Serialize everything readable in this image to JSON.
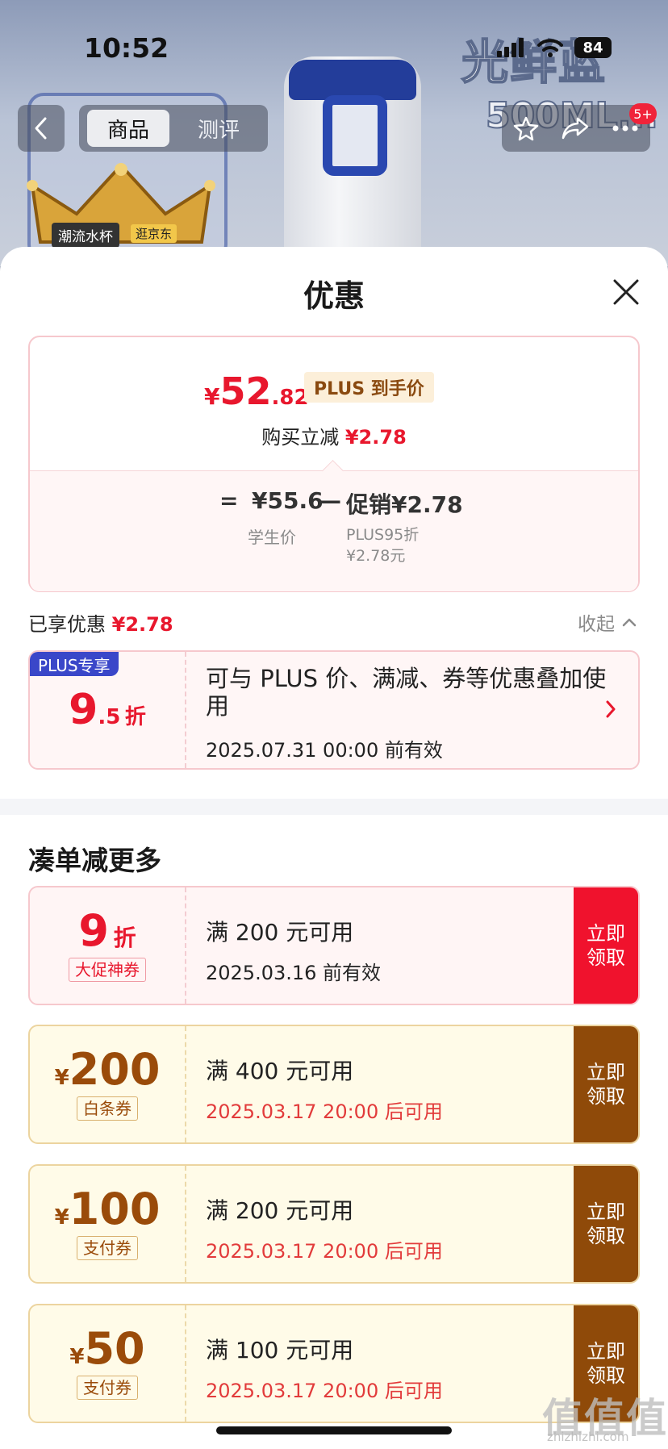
{
  "status_bar": {
    "time": "10:52",
    "battery": "84"
  },
  "hero": {
    "title": "光鲜蓝",
    "subtitle": "500ML...",
    "crown_tag": "潮流水杯",
    "crown_tag2": "逛京东"
  },
  "nav": {
    "tabs": [
      {
        "label": "商品"
      },
      {
        "label": "测评"
      }
    ],
    "badge": "5+"
  },
  "sheet": {
    "title": "优惠",
    "price_card": {
      "yen": "¥",
      "price_int": "52",
      "price_dec": ".82",
      "tag": "PLUS 到手价",
      "reduce_label": "购买立减",
      "reduce_value": "¥2.78",
      "eq": "=",
      "student_price": "¥55.6",
      "minus": "—",
      "promo": "促销¥2.78",
      "student_label": "学生价",
      "plus_label_1": "PLUS95折",
      "plus_label_2": "¥2.78元"
    },
    "enjoyed_label": "已享优惠",
    "enjoyed_value": "¥2.78",
    "collapse_label": "收起",
    "plus_coupon": {
      "corner": "PLUS专享",
      "disc_num": "9",
      "disc_dec": ".5",
      "disc_unit": "折",
      "desc": "可与 PLUS 价、满减、券等优惠叠加使用",
      "valid": "2025.07.31 00:00 前有效"
    },
    "section_title": "凑单减更多",
    "coupons": [
      {
        "yen": "",
        "num": "9",
        "unit": "折",
        "type": "大促神券",
        "cond": "满 200 元可用",
        "valid": "2025.03.16 前有效",
        "claim": "立即领取"
      },
      {
        "yen": "¥",
        "num": "200",
        "unit": "",
        "type": "白条券",
        "cond": "满 400 元可用",
        "valid": "2025.03.17 20:00 后可用",
        "claim": "立即领取"
      },
      {
        "yen": "¥",
        "num": "100",
        "unit": "",
        "type": "支付券",
        "cond": "满 200 元可用",
        "valid": "2025.03.17 20:00 后可用",
        "claim": "立即领取"
      },
      {
        "yen": "¥",
        "num": "50",
        "unit": "",
        "type": "支付券",
        "cond": "满 100 元可用",
        "valid": "2025.03.17 20:00 后可用",
        "claim": "立即领取"
      }
    ]
  },
  "watermark": {
    "logo": "值值值",
    "site": "zhizhizhi.com"
  },
  "colors": {
    "accent_red": "#e8172d",
    "gold": "#8f4a09",
    "plus_blue": "#3a47c9"
  }
}
